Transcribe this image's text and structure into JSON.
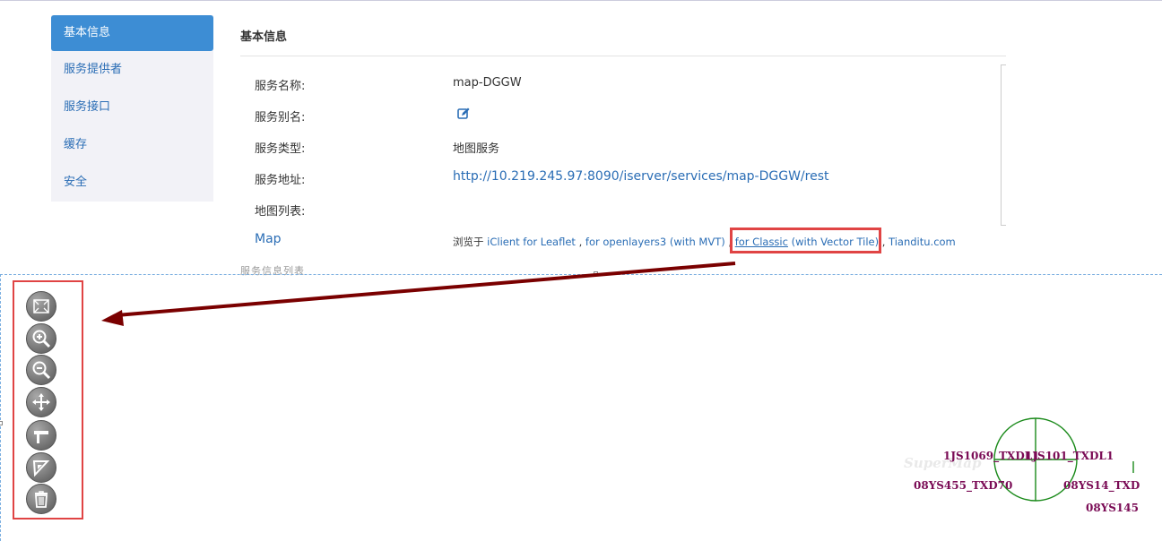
{
  "sidebar": {
    "items": [
      {
        "label": "基本信息",
        "active": true
      },
      {
        "label": "服务提供者",
        "active": false
      },
      {
        "label": "服务接口",
        "active": false
      },
      {
        "label": "缓存",
        "active": false
      },
      {
        "label": "安全",
        "active": false
      }
    ]
  },
  "panel": {
    "title": "基本信息",
    "rows": [
      {
        "label": "服务名称:",
        "value": "map-DGGW"
      },
      {
        "label": "服务别名:",
        "value": ""
      },
      {
        "label": "服务类型:",
        "value": "地图服务"
      },
      {
        "label": "服务地址:",
        "value": "http://10.219.245.97:8090/iserver/services/map-DGGW/rest"
      },
      {
        "label": "地图列表:",
        "value": ""
      }
    ],
    "map_link": "Map",
    "browse": {
      "prefix": "浏览于",
      "leaflet": "iClient for Leaflet",
      "sep1": ",",
      "openlayers": "for openlayers3",
      "mvt": "(with MVT)",
      "sep2": ",",
      "classic": "for Classic",
      "vector_tile": "(with Vector Tile)",
      "sep3": ",",
      "tianditu": "Tianditu.com"
    }
  },
  "map": {
    "ghost_text": "服务信息列表",
    "watermark": "SuperMap",
    "labels": [
      "1JS1069_TXDL1",
      "1JS101_TXDL1",
      "08YS455_TXD70",
      "08YS14_TXD",
      "08YS145"
    ],
    "tools": [
      {
        "name": "full-extent-icon"
      },
      {
        "name": "zoom-in-icon"
      },
      {
        "name": "zoom-out-icon"
      },
      {
        "name": "pan-icon"
      },
      {
        "name": "measure-distance-icon"
      },
      {
        "name": "measure-area-icon"
      },
      {
        "name": "clear-icon"
      }
    ]
  },
  "colors": {
    "accent": "#3d8dd4",
    "link": "#2a6db5",
    "highlight": "#e04444",
    "arrow": "#7a0000",
    "map_label": "#7a0b55",
    "feature_line": "#1a8a1a"
  }
}
